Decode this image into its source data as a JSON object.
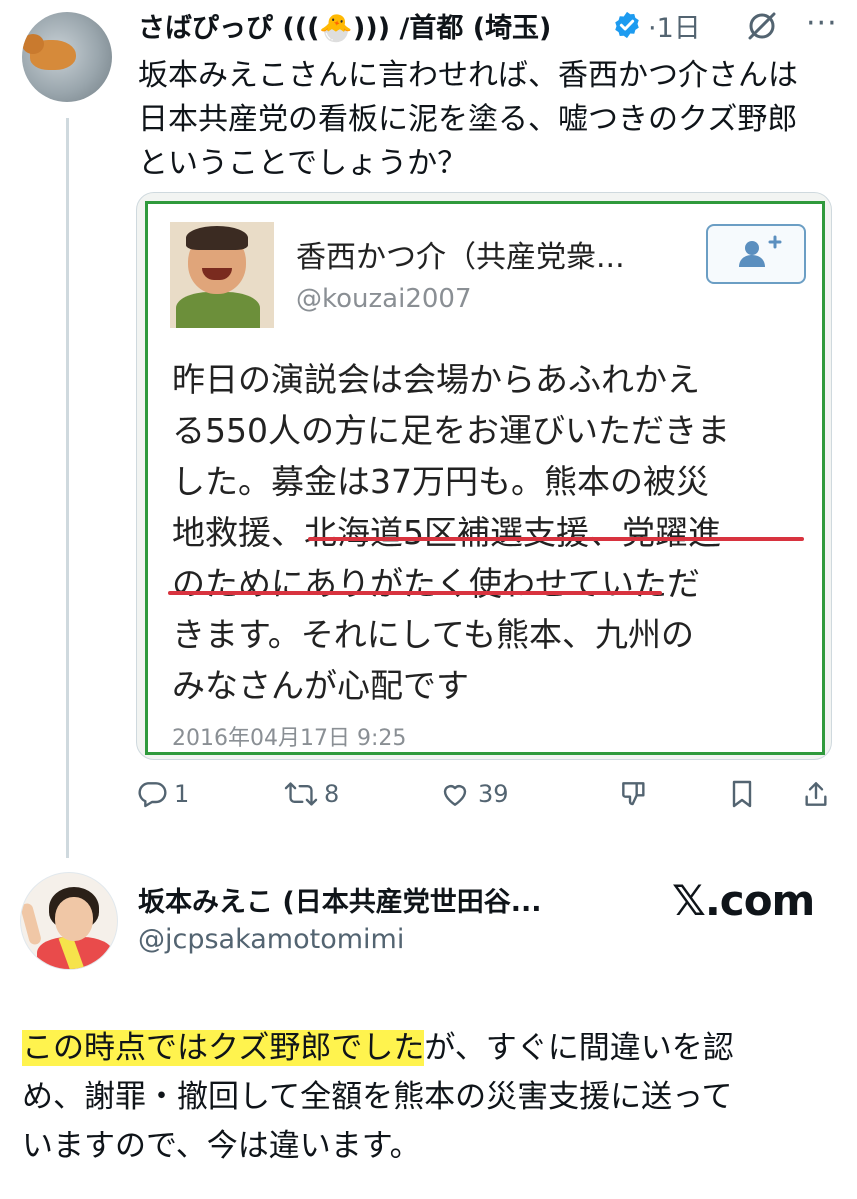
{
  "tweet": {
    "author_name": "さばぴっぴ (((🐣))) /首都 (埼玉)",
    "separator": "·",
    "time": "1日",
    "text_lines": [
      "坂本みえこさんに言わせれば、香西かつ介さんは",
      "日本共産党の看板に泥を塗る、嘘つきのクズ野郎",
      "ということでしょうか？"
    ],
    "actions": {
      "replies": "1",
      "retweets": "8",
      "likes": "39"
    },
    "colors": {
      "verified": "#1d9bf0",
      "thread_line": "#cfd9de",
      "secondary_text": "#536471"
    }
  },
  "embedded_screenshot": {
    "display_name": "香西かつ介（共産党衆...",
    "handle": "@kouzai2007",
    "lines": [
      "昨日の演説会は会場からあふれかえ",
      "る550人の方に足をお運びいただきま",
      "した。募金は37万円も。熊本の被災",
      "地救援、北海道5区補選支援、党躍進",
      "のためにありがたく使わせていただ",
      "きます。それにしても熊本、九州の",
      "みなさんが心配です"
    ],
    "date": "2016年04月17日 9:25",
    "border_color": "#2f9a3c",
    "underline_color": "#d8333f"
  },
  "quoted_card": {
    "name": "坂本みえこ (日本共産党世田谷...",
    "handle": "@jcpsakamotomimi",
    "source": "𝕏.com"
  },
  "body": {
    "highlighted": "この時点ではクズ野郎でした",
    "line1_rest": "が、すぐに間違いを認",
    "line2": "め、謝罪・撤回して全額を熊本の災害支援に送って",
    "line3": "いますので、今は違います。",
    "highlight_color": "#fff34e"
  }
}
